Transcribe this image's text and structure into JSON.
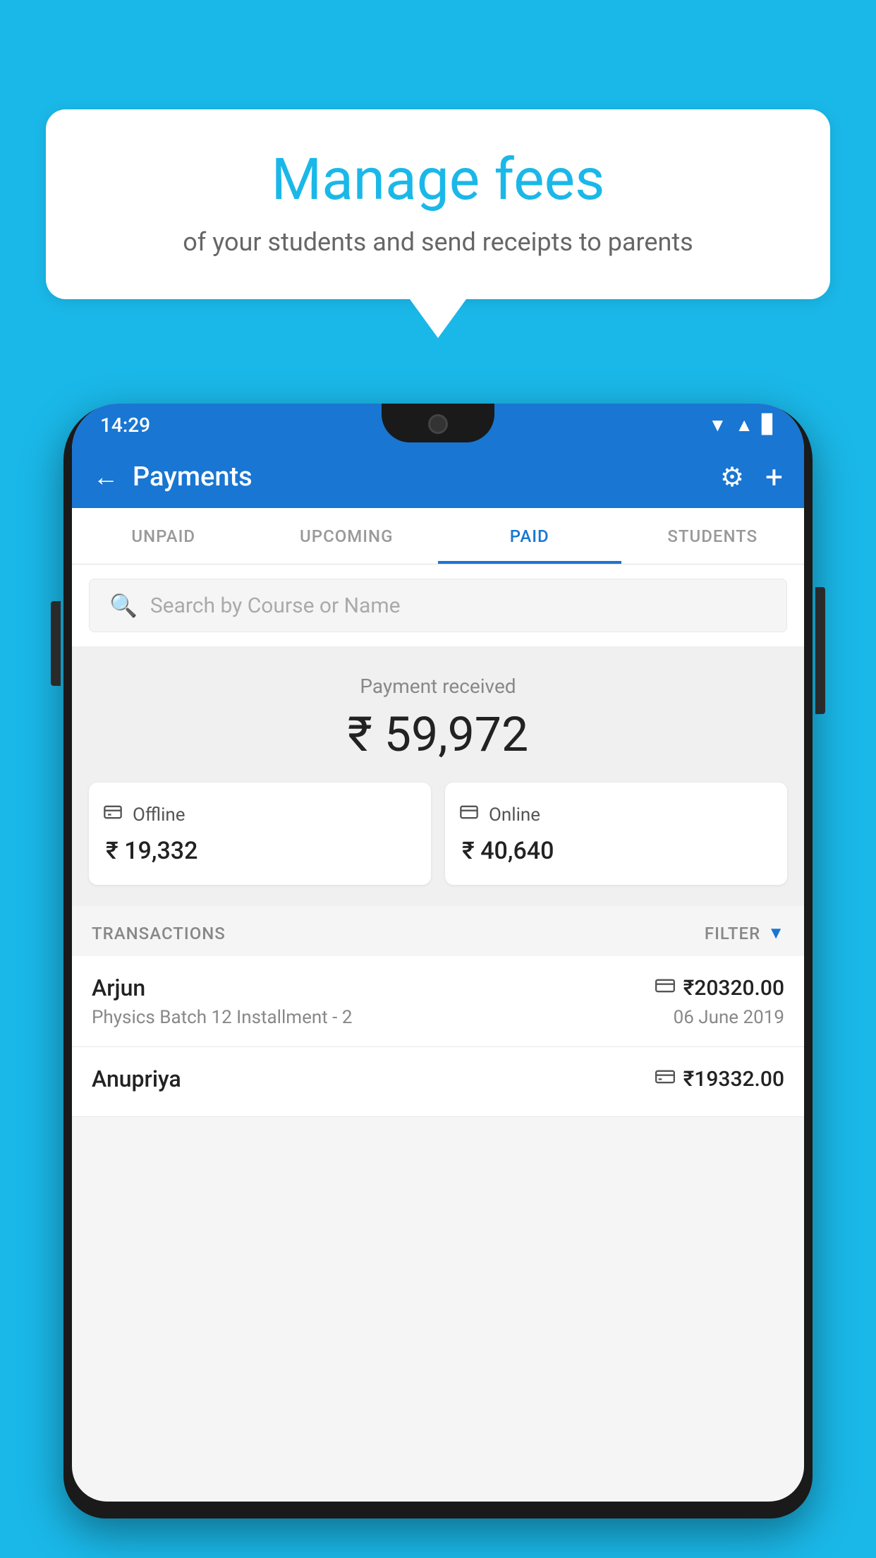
{
  "background_color": "#1ab8e8",
  "speech_bubble": {
    "title": "Manage fees",
    "subtitle": "of your students and send receipts to parents"
  },
  "status_bar": {
    "time": "14:29"
  },
  "header": {
    "title": "Payments",
    "back_label": "←",
    "settings_label": "⚙",
    "add_label": "+"
  },
  "tabs": [
    {
      "label": "UNPAID",
      "active": false
    },
    {
      "label": "UPCOMING",
      "active": false
    },
    {
      "label": "PAID",
      "active": true
    },
    {
      "label": "STUDENTS",
      "active": false
    }
  ],
  "search": {
    "placeholder": "Search by Course or Name"
  },
  "payment_summary": {
    "received_label": "Payment received",
    "total_amount": "₹ 59,972",
    "offline": {
      "icon": "💳",
      "type": "Offline",
      "amount": "₹ 19,332"
    },
    "online": {
      "icon": "💳",
      "type": "Online",
      "amount": "₹ 40,640"
    }
  },
  "transactions": {
    "header_label": "TRANSACTIONS",
    "filter_label": "FILTER",
    "items": [
      {
        "name": "Arjun",
        "type_icon": "💳",
        "amount": "₹20320.00",
        "description": "Physics Batch 12 Installment - 2",
        "date": "06 June 2019"
      },
      {
        "name": "Anupriya",
        "type_icon": "💵",
        "amount": "₹19332.00",
        "description": "",
        "date": ""
      }
    ]
  }
}
